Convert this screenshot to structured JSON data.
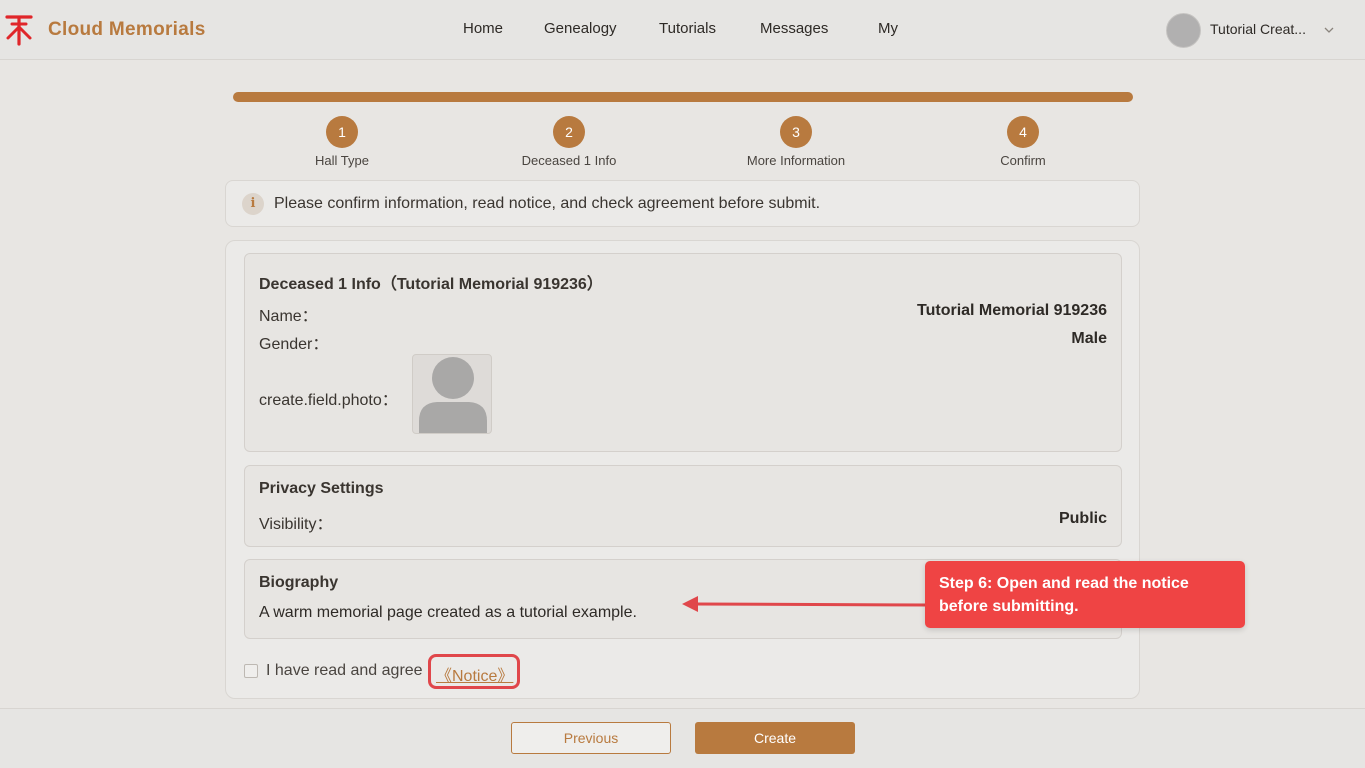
{
  "header": {
    "brand": "Cloud Memorials",
    "nav": [
      "Home",
      "Genealogy",
      "Tutorials",
      "Messages",
      "My"
    ],
    "user_name": "Tutorial Creat...",
    "logo_icon": "memorial-logo-icon"
  },
  "steps": [
    {
      "number": "1",
      "label": "Hall Type"
    },
    {
      "number": "2",
      "label": "Deceased 1 Info"
    },
    {
      "number": "3",
      "label": "More Information"
    },
    {
      "number": "4",
      "label": "Confirm"
    }
  ],
  "progress_fraction": 1.0,
  "alert": {
    "icon": "i",
    "text": "Please confirm information, read notice, and check agreement before submit."
  },
  "deceased": {
    "title": "Deceased 1 Info（Tutorial Memorial 919236）",
    "name_label": "Name：",
    "name_value": "Tutorial Memorial 919236",
    "gender_label": "Gender：",
    "gender_value": "Male",
    "photo_label": "create.field.photo："
  },
  "privacy": {
    "title": "Privacy Settings",
    "visibility_label": "Visibility：",
    "visibility_value": "Public"
  },
  "biography": {
    "title": "Biography",
    "text": "A warm memorial page created as a tutorial example."
  },
  "agreement": {
    "checked": false,
    "text": "I have read and agree",
    "link": "《Notice》"
  },
  "buttons": {
    "previous": "Previous",
    "create": "Create"
  },
  "annotation": {
    "text": "Step 6: Open and read the notice before submitting."
  },
  "colors": {
    "accent": "#b87a3f",
    "annotation": "#ef4444",
    "logo": "#e0262a"
  }
}
